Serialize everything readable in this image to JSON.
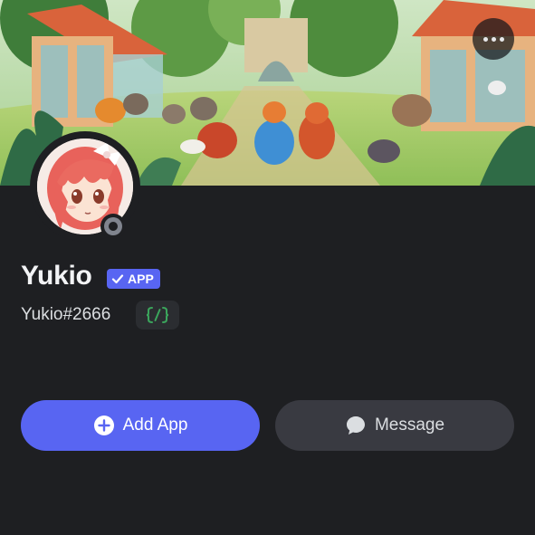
{
  "banner": {
    "more_icon": "more-horizontal-icon"
  },
  "profile": {
    "username": "Yukio",
    "badge_label": "APP",
    "tag": "Yukio#2666",
    "status": "offline",
    "dev_badge_icon": "slash-command-icon"
  },
  "actions": {
    "add_app_label": "Add App",
    "message_label": "Message"
  },
  "colors": {
    "background": "#1e1f22",
    "accent": "#5865f2",
    "secondary_button": "#393a41",
    "status_offline": "#80848e",
    "dev_badge_icon": "#3ba55c"
  }
}
